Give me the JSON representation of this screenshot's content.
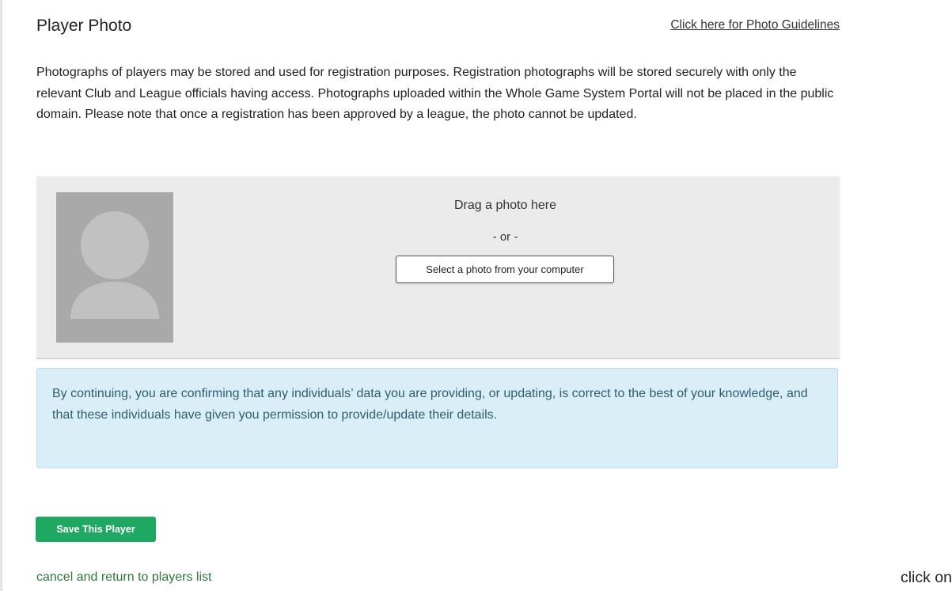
{
  "section": {
    "title": "Player Photo",
    "guidelines_link": "Click here for Photo Guidelines",
    "intro": "Photographs of players may be stored and used for registration purposes. Registration photographs will be stored securely with only the relevant Club and League officials having access. Photographs uploaded within the Whole Game System Portal will not be placed in the public domain. Please note that once a registration has been approved by a league, the photo cannot be updated."
  },
  "uploader": {
    "drag_text": "Drag a photo here",
    "or_text": "- or -",
    "select_button": "Select a photo from your computer",
    "avatar_icon": "person-silhouette-icon"
  },
  "notice": {
    "text": "By continuing, you are confirming that any individuals’ data you are providing, or updating, is correct to the best of your knowledge, and that these individuals have given you permission to provide/update their details."
  },
  "actions": {
    "save_label": "Save This Player",
    "cancel_label": "cancel and return to players list"
  },
  "annotation": {
    "text": "click on"
  },
  "colors": {
    "primary_green": "#1fa862",
    "link_green": "#2c7a3a",
    "notice_bg": "#d9eef7",
    "notice_text": "#2f5e72",
    "dropzone_bg": "#ebebeb",
    "avatar_bg": "#a9a9a9"
  }
}
